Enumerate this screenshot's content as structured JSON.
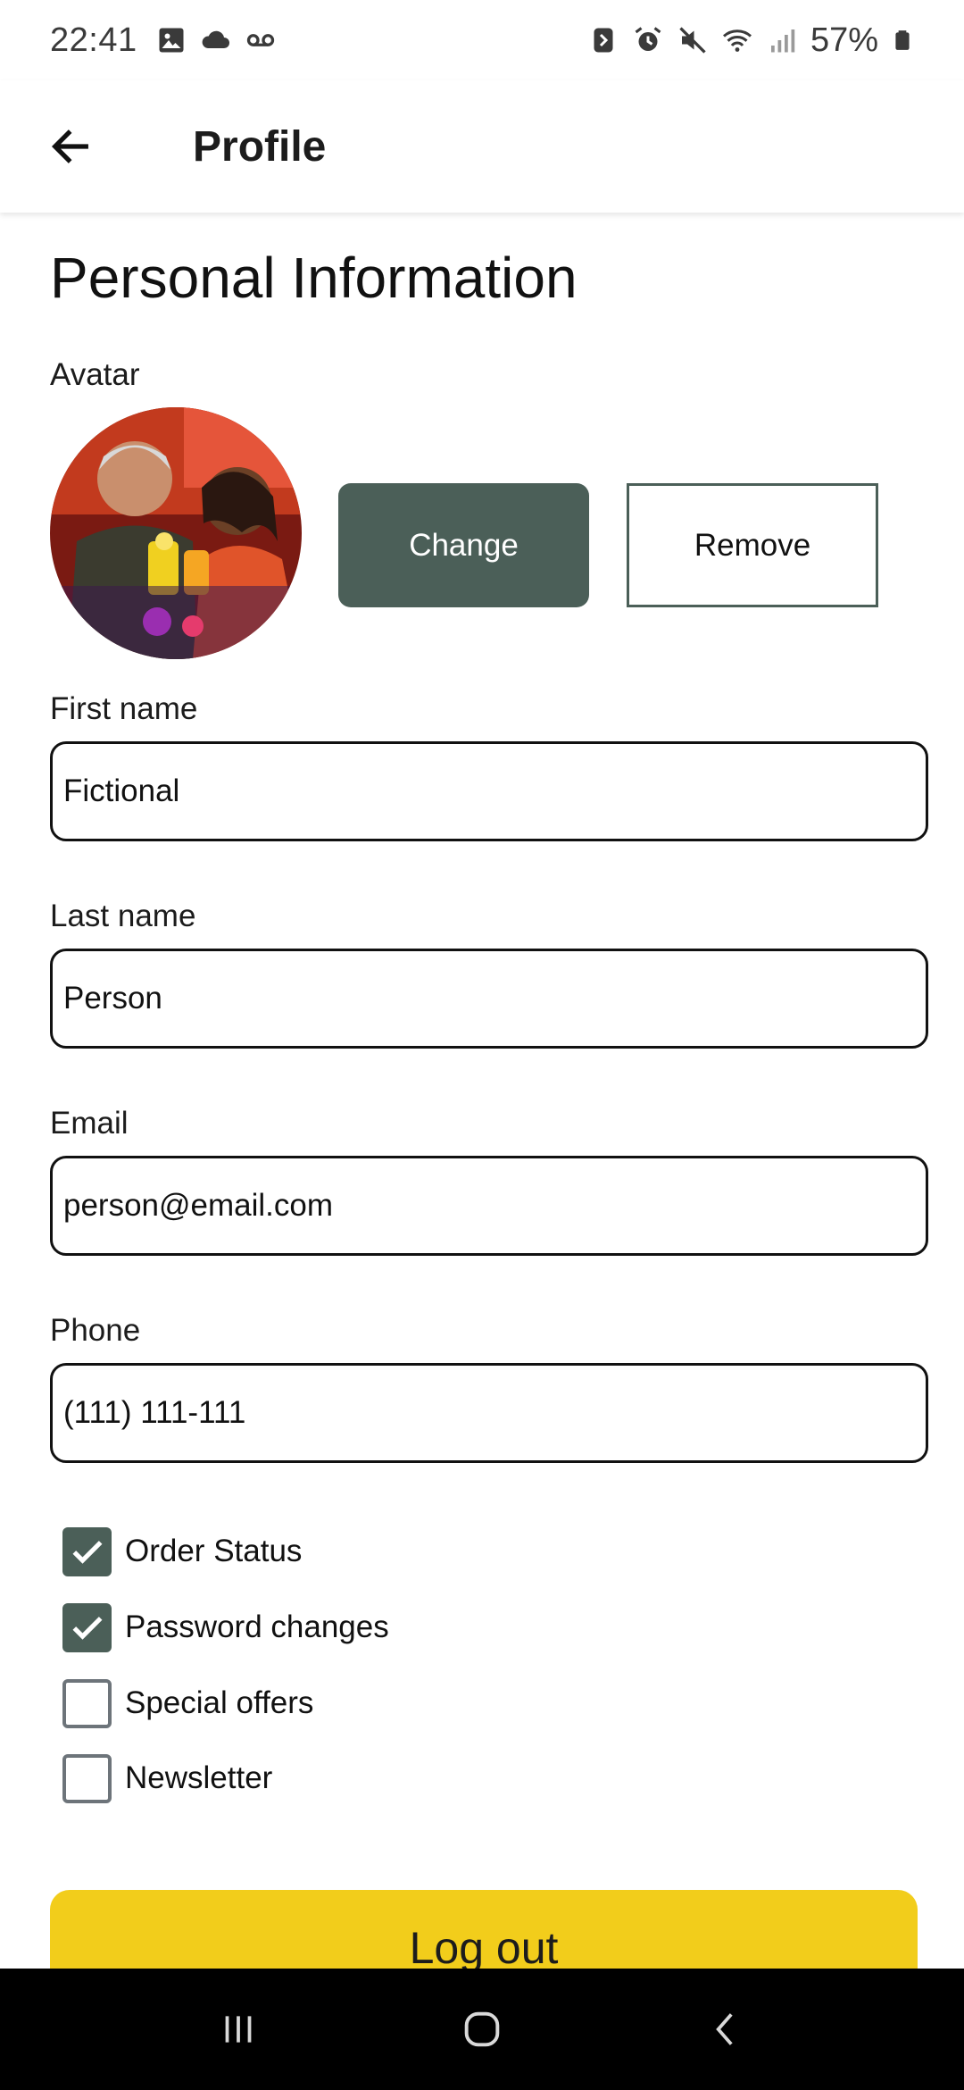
{
  "status_bar": {
    "time": "22:41",
    "battery_percent": "57%",
    "left_icons": [
      "gallery-icon",
      "cloud-icon",
      "voicemail-icon"
    ],
    "right_icons": [
      "nfc-icon",
      "alarm-icon",
      "mute-icon",
      "wifi-icon",
      "signal-icon",
      "battery-icon"
    ]
  },
  "app_bar": {
    "title": "Profile",
    "back_icon": "arrow-left-icon"
  },
  "personal_info": {
    "title": "Personal Information",
    "avatar_label": "Avatar",
    "change_label": "Change",
    "remove_label": "Remove"
  },
  "fields": {
    "first_name": {
      "label": "First name",
      "value": "Fictional"
    },
    "last_name": {
      "label": "Last name",
      "value": "Person"
    },
    "email": {
      "label": "Email",
      "value": "person@email.com"
    },
    "phone": {
      "label": "Phone",
      "value": "(111) 111-111"
    }
  },
  "notifications": [
    {
      "label": "Order Status",
      "checked": true
    },
    {
      "label": "Password changes",
      "checked": true
    },
    {
      "label": "Special offers",
      "checked": false
    },
    {
      "label": "Newsletter",
      "checked": false
    }
  ],
  "logout_label": "Log out",
  "colors": {
    "accent": "#4b5f58",
    "logout": "#f2cd1b",
    "nav_bar": "#000000"
  },
  "nav_bar": {
    "recents_icon": "recents-icon",
    "home_icon": "home-icon",
    "back_icon": "nav-back-icon"
  }
}
